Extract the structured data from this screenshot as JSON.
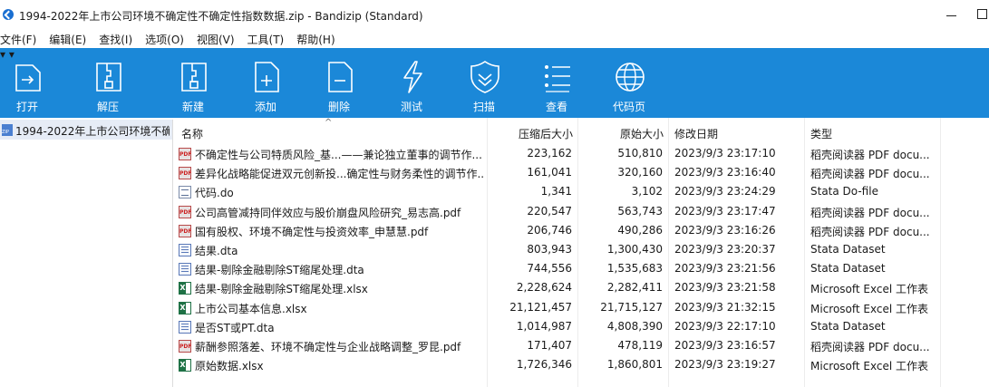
{
  "window": {
    "title": "1994-2022年上市公司环境不确定性不确定性指数数据.zip - Bandizip (Standard)"
  },
  "menu": [
    "文件(F)",
    "编辑(E)",
    "查找(I)",
    "选项(O)",
    "视图(V)",
    "工具(T)",
    "帮助(H)"
  ],
  "toolbar": {
    "open": "打开",
    "extract": "解压",
    "new": "新建",
    "add": "添加",
    "delete": "删除",
    "test": "测试",
    "scan": "扫描",
    "view": "查看",
    "codepage": "代码页"
  },
  "tree": {
    "archive": "1994-2022年上市公司环境不确"
  },
  "columns": {
    "name": "名称",
    "compressed": "压缩后大小",
    "original": "原始大小",
    "modified": "修改日期",
    "type": "类型"
  },
  "files": [
    {
      "icon": "pdf",
      "name": "不确定性与公司特质风险_基...——兼论独立董事的调节作...",
      "compressed": "223,162",
      "original": "510,810",
      "modified": "2023/9/3 23:17:10",
      "type": "稻壳阅读器 PDF docu..."
    },
    {
      "icon": "pdf",
      "name": "差异化战略能促进双元创新投...确定性与财务柔性的调节作...",
      "compressed": "161,041",
      "original": "320,160",
      "modified": "2023/9/3 23:16:40",
      "type": "稻壳阅读器 PDF docu..."
    },
    {
      "icon": "do",
      "name": "代码.do",
      "compressed": "1,341",
      "original": "3,102",
      "modified": "2023/9/3 23:24:29",
      "type": "Stata Do-file"
    },
    {
      "icon": "pdf",
      "name": "公司高管减持同伴效应与股价崩盘风险研究_易志高.pdf",
      "compressed": "220,547",
      "original": "563,743",
      "modified": "2023/9/3 23:17:47",
      "type": "稻壳阅读器 PDF docu..."
    },
    {
      "icon": "pdf",
      "name": "国有股权、环境不确定性与投资效率_申慧慧.pdf",
      "compressed": "206,746",
      "original": "490,286",
      "modified": "2023/9/3 23:16:26",
      "type": "稻壳阅读器 PDF docu..."
    },
    {
      "icon": "dta",
      "name": "结果.dta",
      "compressed": "803,943",
      "original": "1,300,430",
      "modified": "2023/9/3 23:20:37",
      "type": "Stata Dataset"
    },
    {
      "icon": "dta",
      "name": "结果-剔除金融剔除ST缩尾处理.dta",
      "compressed": "744,556",
      "original": "1,535,683",
      "modified": "2023/9/3 23:21:56",
      "type": "Stata Dataset"
    },
    {
      "icon": "xlsx",
      "name": "结果-剔除金融剔除ST缩尾处理.xlsx",
      "compressed": "2,228,624",
      "original": "2,282,411",
      "modified": "2023/9/3 23:21:58",
      "type": "Microsoft Excel 工作表"
    },
    {
      "icon": "xlsx",
      "name": "上市公司基本信息.xlsx",
      "compressed": "21,121,457",
      "original": "21,715,127",
      "modified": "2023/9/3 21:32:15",
      "type": "Microsoft Excel 工作表"
    },
    {
      "icon": "dta",
      "name": "是否ST或PT.dta",
      "compressed": "1,014,987",
      "original": "4,808,390",
      "modified": "2023/9/3 22:17:10",
      "type": "Stata Dataset"
    },
    {
      "icon": "pdf",
      "name": "薪酬参照落差、环境不确定性与企业战略调整_罗昆.pdf",
      "compressed": "171,407",
      "original": "478,119",
      "modified": "2023/9/3 23:16:57",
      "type": "稻壳阅读器 PDF docu..."
    },
    {
      "icon": "xlsx",
      "name": "原始数据.xlsx",
      "compressed": "1,726,346",
      "original": "1,860,801",
      "modified": "2023/9/3 23:19:27",
      "type": "Microsoft Excel 工作表"
    }
  ]
}
